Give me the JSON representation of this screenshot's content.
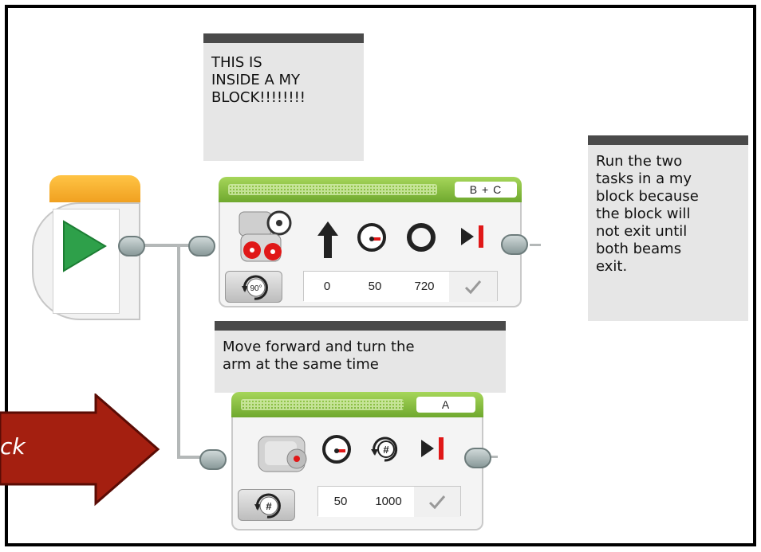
{
  "comments": {
    "inside": "THIS IS\nINSIDE A MY\nBLOCK!!!!!!!!",
    "right": "Run the two\ntasks in a my\nblock because\nthe block will\nnot exit until\nboth beams\nexit.",
    "middle": "Move forward and turn the\narm at the same time"
  },
  "move_steering_block": {
    "port": "B + C",
    "values": [
      "0",
      "50",
      "720"
    ],
    "icons": [
      "dual-motor-steering-icon",
      "steering-arrow-icon",
      "power-gauge-icon",
      "rotations-circle-icon",
      "brake-at-end-icon"
    ],
    "mode_icon": "degrees-mode-icon",
    "mode_label": "90°"
  },
  "medium_motor_block": {
    "port": "A",
    "values": [
      "50",
      "1000"
    ],
    "icons": [
      "medium-motor-icon",
      "power-gauge-icon",
      "degrees-icon",
      "brake-at-end-icon"
    ],
    "mode_icon": "degrees-mode-icon",
    "mode_label": "#"
  },
  "callout": {
    "text": "ck"
  },
  "colors": {
    "accent_green": "#6fa82e",
    "start_orange": "#f0a020",
    "arrow_red": "#a41f10",
    "play_green": "#2ea04a",
    "brake_red": "#e01818"
  }
}
